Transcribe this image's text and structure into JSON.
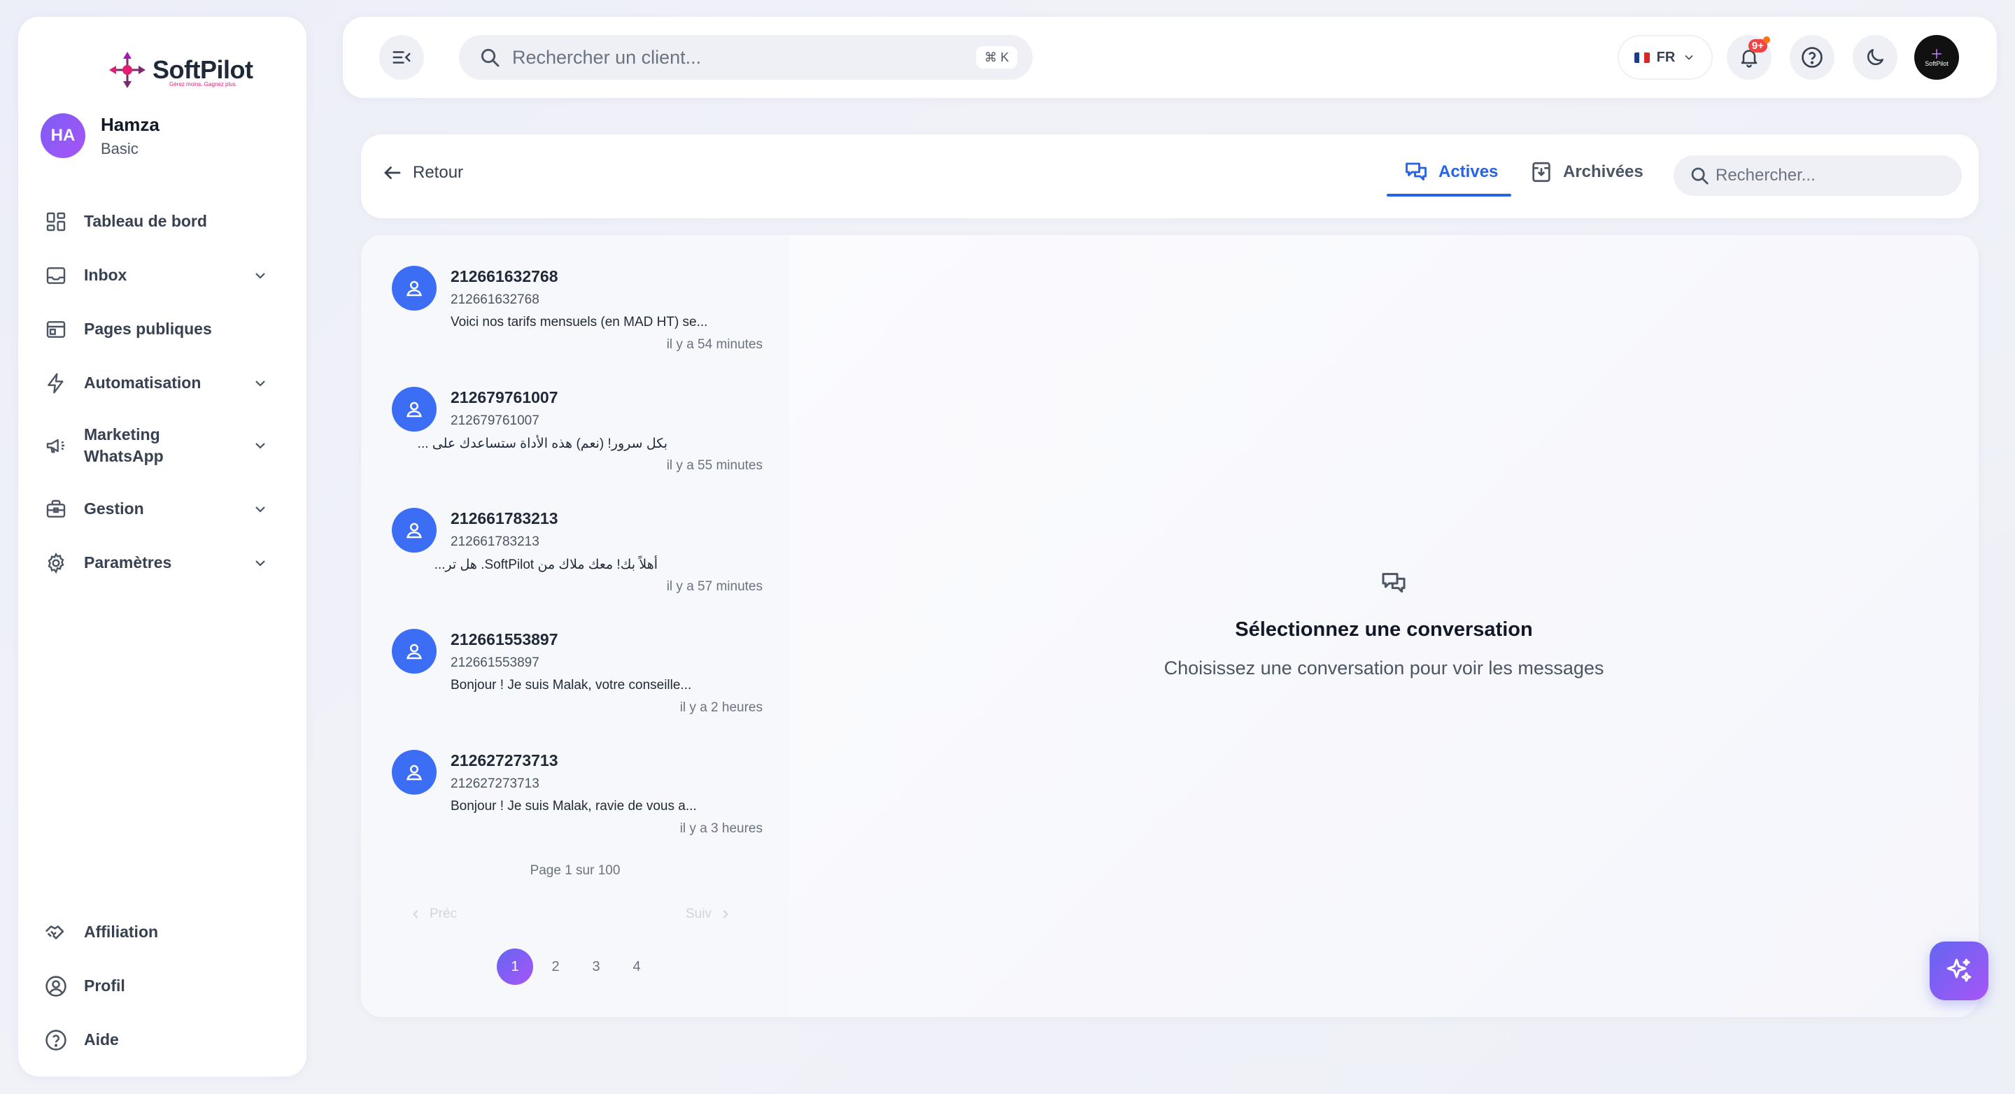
{
  "brand": {
    "name": "SoftPilot",
    "tagline": "Gérez moins. Gagnez plus."
  },
  "user": {
    "initials": "HA",
    "name": "Hamza",
    "plan": "Basic"
  },
  "sidebar": {
    "items": [
      {
        "label": "Tableau de bord",
        "icon": "dashboard-icon"
      },
      {
        "label": "Inbox",
        "icon": "inbox-icon",
        "expandable": true
      },
      {
        "label": "Pages publiques",
        "icon": "browser-icon"
      },
      {
        "label": "Automatisation",
        "icon": "lightning-icon",
        "expandable": true
      },
      {
        "label": "Marketing WhatsApp",
        "icon": "megaphone-icon",
        "expandable": true
      },
      {
        "label": "Gestion",
        "icon": "briefcase-icon",
        "expandable": true
      },
      {
        "label": "Paramètres",
        "icon": "gear-icon",
        "expandable": true
      }
    ],
    "bottom_items": [
      {
        "label": "Affiliation",
        "icon": "handshake-icon"
      },
      {
        "label": "Profil",
        "icon": "user-circle-icon"
      },
      {
        "label": "Aide",
        "icon": "help-icon"
      }
    ]
  },
  "header": {
    "search_placeholder": "Rechercher un client...",
    "search_shortcut": "⌘ K",
    "language": "FR",
    "notification_count": "9+",
    "account_label": "SoftPilot"
  },
  "subheader": {
    "back_label": "Retour",
    "tabs": [
      {
        "label": "Actives",
        "active": true
      },
      {
        "label": "Archivées",
        "active": false
      }
    ],
    "search_placeholder": "Rechercher..."
  },
  "conversations": [
    {
      "name": "212661632768",
      "phone": "212661632768",
      "preview": "Voici nos tarifs mensuels (en MAD HT) se...",
      "time": "il y a 54 minutes"
    },
    {
      "name": "212679761007",
      "phone": "212679761007",
      "preview": "بكل سرور! (نعم) هذه الأداة ستساعدك على ...",
      "time": "il y a 55 minutes"
    },
    {
      "name": "212661783213",
      "phone": "212661783213",
      "preview": "أهلاً بك! معك ملاك من SoftPilot. هل تر...",
      "time": "il y a 57 minutes"
    },
    {
      "name": "212661553897",
      "phone": "212661553897",
      "preview": "Bonjour ! Je suis Malak, votre conseille...",
      "time": "il y a 2 heures"
    },
    {
      "name": "212627273713",
      "phone": "212627273713",
      "preview": "Bonjour ! Je suis Malak, ravie de vous a...",
      "time": "il y a 3 heures"
    }
  ],
  "pagination": {
    "info": "Page 1 sur 100",
    "prev_label": "Préc",
    "next_label": "Suiv",
    "pages": [
      "1",
      "2",
      "3",
      "4"
    ],
    "current": "1"
  },
  "empty_state": {
    "title": "Sélectionnez une conversation",
    "subtitle": "Choisissez une conversation pour voir les messages"
  },
  "colors": {
    "accent": "#2563eb",
    "avatar_blue": "#3b6ef5",
    "gradient_start": "#6366f1",
    "gradient_end": "#a855f7"
  }
}
